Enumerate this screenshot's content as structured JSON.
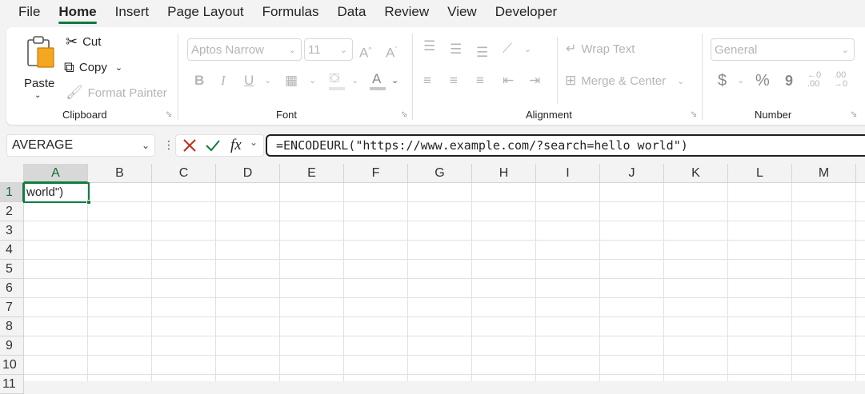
{
  "menu": {
    "items": [
      "File",
      "Home",
      "Insert",
      "Page Layout",
      "Formulas",
      "Data",
      "Review",
      "View",
      "Developer"
    ],
    "active": "Home"
  },
  "ribbon": {
    "clipboard": {
      "paste": "Paste",
      "cut": "Cut",
      "copy": "Copy",
      "format_painter": "Format Painter",
      "label": "Clipboard"
    },
    "font": {
      "family": "Aptos Narrow",
      "size": "11",
      "label": "Font",
      "bold": "B",
      "italic": "I",
      "underline": "U"
    },
    "alignment": {
      "wrap_text": "Wrap Text",
      "merge_center": "Merge & Center",
      "label": "Alignment"
    },
    "number": {
      "format": "General",
      "label": "Number",
      "currency": "$",
      "percent": "%",
      "comma": "9"
    }
  },
  "formula_bar": {
    "name_box": "AVERAGE",
    "fx": "fx",
    "formula": "=ENCODEURL(\"https://www.example.com/?search=hello world\")"
  },
  "sheet": {
    "columns": [
      "A",
      "B",
      "C",
      "D",
      "E",
      "F",
      "G",
      "H",
      "I",
      "J",
      "K",
      "L",
      "M"
    ],
    "rows": [
      "1",
      "2",
      "3",
      "4",
      "5",
      "6",
      "7",
      "8",
      "9",
      "10",
      "11"
    ],
    "selected_column": "A",
    "selected_row": "1",
    "cell_a1": "world\")"
  },
  "colors": {
    "accent": "#107c41",
    "cancel": "#c42b1c",
    "enter": "#107c41"
  }
}
